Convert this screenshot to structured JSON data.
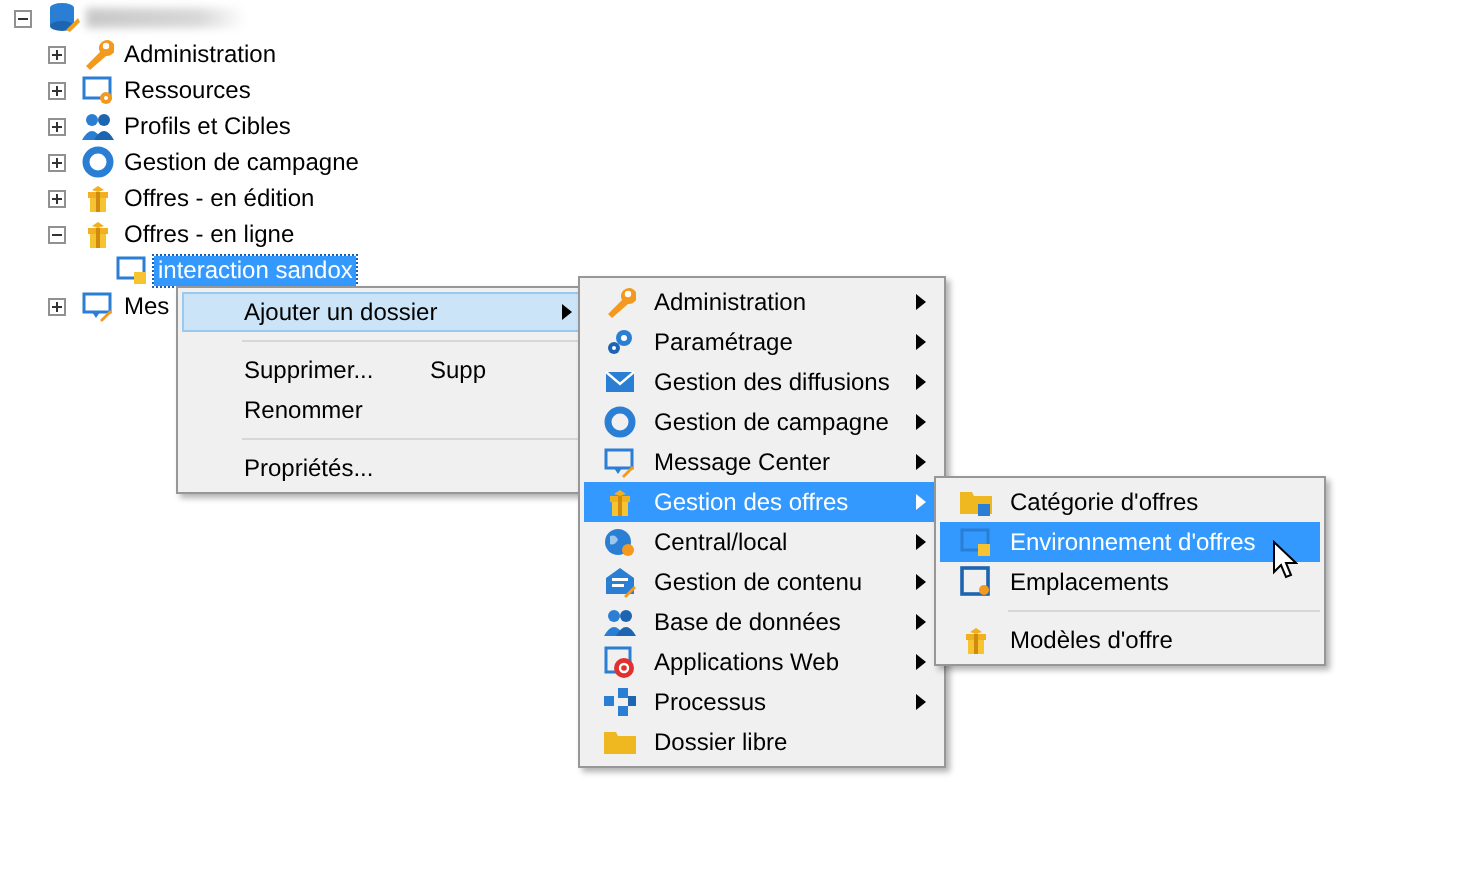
{
  "tree": {
    "expanded": true,
    "children": [
      {
        "label": "Administration",
        "expanded": false,
        "selected": false
      },
      {
        "label": "Ressources",
        "expanded": false,
        "selected": false
      },
      {
        "label": "Profils et Cibles",
        "expanded": false,
        "selected": false
      },
      {
        "label": "Gestion de campagne",
        "expanded": false,
        "selected": false
      },
      {
        "label": "Offres - en édition",
        "expanded": false,
        "selected": false
      },
      {
        "label": "Offres - en ligne",
        "expanded": true,
        "selected": false,
        "children": [
          {
            "label": "interaction sandox",
            "selected": true
          }
        ]
      },
      {
        "label": "Mes",
        "expanded": false,
        "selected": false
      }
    ]
  },
  "context_menu": {
    "groups": [
      [
        {
          "label": "Ajouter un dossier",
          "submenu": true,
          "selected": true
        }
      ],
      [
        {
          "label": "Supprimer...",
          "shortcut": "Supp",
          "submenu": false,
          "selected": false
        },
        {
          "label": "Renommer",
          "submenu": false,
          "selected": false
        }
      ],
      [
        {
          "label": "Propriétés...",
          "submenu": false,
          "selected": false
        }
      ]
    ]
  },
  "folder_menu": {
    "groups": [
      [
        {
          "label": "Administration",
          "submenu": true,
          "selected": false
        },
        {
          "label": "Paramétrage",
          "submenu": true,
          "selected": false
        },
        {
          "label": "Gestion des diffusions",
          "submenu": true,
          "selected": false
        },
        {
          "label": "Gestion de campagne",
          "submenu": true,
          "selected": false
        },
        {
          "label": "Message Center",
          "submenu": true,
          "selected": false
        },
        {
          "label": "Gestion des offres",
          "submenu": true,
          "selected": true
        },
        {
          "label": "Central/local",
          "submenu": true,
          "selected": false
        },
        {
          "label": "Gestion de contenu",
          "submenu": true,
          "selected": false
        },
        {
          "label": "Base de données",
          "submenu": true,
          "selected": false
        },
        {
          "label": "Applications Web",
          "submenu": true,
          "selected": false
        },
        {
          "label": "Processus",
          "submenu": true,
          "selected": false
        },
        {
          "label": "Dossier libre",
          "submenu": false,
          "selected": false
        }
      ]
    ]
  },
  "offers_menu": {
    "groups": [
      [
        {
          "label": "Catégorie d'offres",
          "submenu": false,
          "selected": false
        },
        {
          "label": "Environnement d'offres",
          "submenu": false,
          "selected": true
        },
        {
          "label": "Emplacements",
          "submenu": false,
          "selected": false
        }
      ],
      [
        {
          "label": "Modèles d'offre",
          "submenu": false,
          "selected": false
        }
      ]
    ]
  }
}
